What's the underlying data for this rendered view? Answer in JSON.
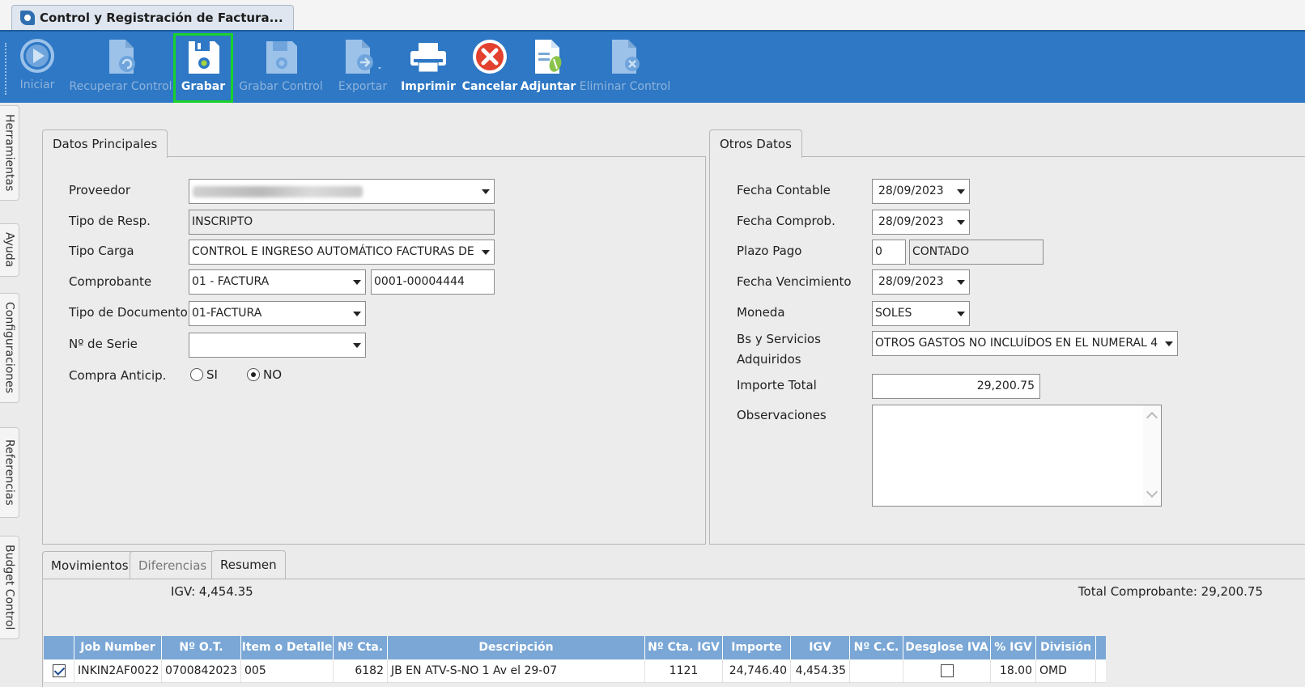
{
  "window": {
    "title": "Control y Registración de Factura..."
  },
  "toolbar": {
    "buttons": [
      {
        "label": "Iniciar",
        "icon": "play-icon",
        "enabled": false
      },
      {
        "label": "Recuperar Control",
        "icon": "recover-document-icon",
        "enabled": false
      },
      {
        "label": "Grabar",
        "icon": "save-disk-icon",
        "enabled": true,
        "highlighted": true
      },
      {
        "label": "Grabar Control",
        "icon": "save-disk-icon",
        "enabled": false
      },
      {
        "label": "Exportar",
        "icon": "export-document-icon",
        "enabled": false
      },
      {
        "label": "Imprimir",
        "icon": "printer-icon",
        "enabled": true
      },
      {
        "label": "Cancelar",
        "icon": "cancel-x-icon",
        "enabled": true
      },
      {
        "label": "Adjuntar",
        "icon": "attach-document-icon",
        "enabled": true
      },
      {
        "label": "Eliminar Control",
        "icon": "delete-document-icon",
        "enabled": false
      }
    ]
  },
  "side_tabs": [
    "Herramientas",
    "Ayuda",
    "Configuraciones",
    "Referencias",
    "Budget Control"
  ],
  "datos_principales": {
    "tab_label": "Datos Principales",
    "proveedor": {
      "label": "Proveedor",
      "value": ""
    },
    "tipo_resp": {
      "label": "Tipo de Resp.",
      "value": "INSCRIPTO"
    },
    "tipo_carga": {
      "label": "Tipo Carga",
      "value": "CONTROL E INGRESO AUTOMÁTICO FACTURAS DE MED"
    },
    "comprobante": {
      "label": "Comprobante",
      "value": "01 - FACTURA",
      "number": "0001-00004444"
    },
    "tipo_documento": {
      "label": "Tipo de Documento",
      "value": "01-FACTURA"
    },
    "nro_serie": {
      "label": "Nº de Serie",
      "value": ""
    },
    "compra_anticip": {
      "label": "Compra Anticip.",
      "option_si": "SI",
      "option_no": "NO",
      "selected": "NO"
    }
  },
  "otros_datos": {
    "tab_label": "Otros Datos",
    "fecha_contable": {
      "label": "Fecha Contable",
      "value": "28/09/2023"
    },
    "fecha_comprob": {
      "label": "Fecha Comprob.",
      "value": "28/09/2023"
    },
    "plazo_pago": {
      "label": "Plazo Pago",
      "days": "0",
      "desc": "CONTADO"
    },
    "fecha_vencimiento": {
      "label": "Fecha Vencimiento",
      "value": "28/09/2023"
    },
    "moneda": {
      "label": "Moneda",
      "value": "SOLES"
    },
    "bs_servicios": {
      "label_line1": "Bs y Servicios",
      "label_line2": "Adquiridos",
      "value": "OTROS GASTOS NO INCLUÍDOS EN EL NUMERAL 4"
    },
    "importe_total": {
      "label": "Importe Total",
      "value": "29,200.75"
    },
    "observaciones": {
      "label": "Observaciones",
      "value": ""
    }
  },
  "bottom_tabs": [
    {
      "label": "Movimientos",
      "active": false
    },
    {
      "label": "Diferencias",
      "active": false
    },
    {
      "label": "Resumen",
      "active": true
    }
  ],
  "resumen": {
    "igv_text": "IGV: 4,454.35",
    "total_text": "Total Comprobante: 29,200.75"
  },
  "grid": {
    "columns": [
      "",
      "Job Number",
      "Nº O.T.",
      "Item o Detalle",
      "Nº Cta.",
      "Descripción",
      "Nº Cta. IGV",
      "Importe",
      "IGV",
      "Nº C.C.",
      "Desglose IVA",
      "% IGV",
      "División"
    ],
    "rows": [
      {
        "checked": true,
        "job_number": "INKIN2AF0022",
        "nro_ot": "0700842023",
        "item": "005",
        "nro_cta": "6182",
        "descripcion": "JB EN ATV-S-NO 1 Av  el 29-07",
        "nro_cta_igv": "1121",
        "importe": "24,746.40",
        "igv": "4,454.35",
        "nro_cc": "",
        "desglose_iva": false,
        "pct_igv": "18.00",
        "division": "OMD"
      }
    ]
  },
  "colors": {
    "toolbar": "#2e78c5",
    "grid_header": "#7aa7d6",
    "highlight": "#19d12b"
  }
}
